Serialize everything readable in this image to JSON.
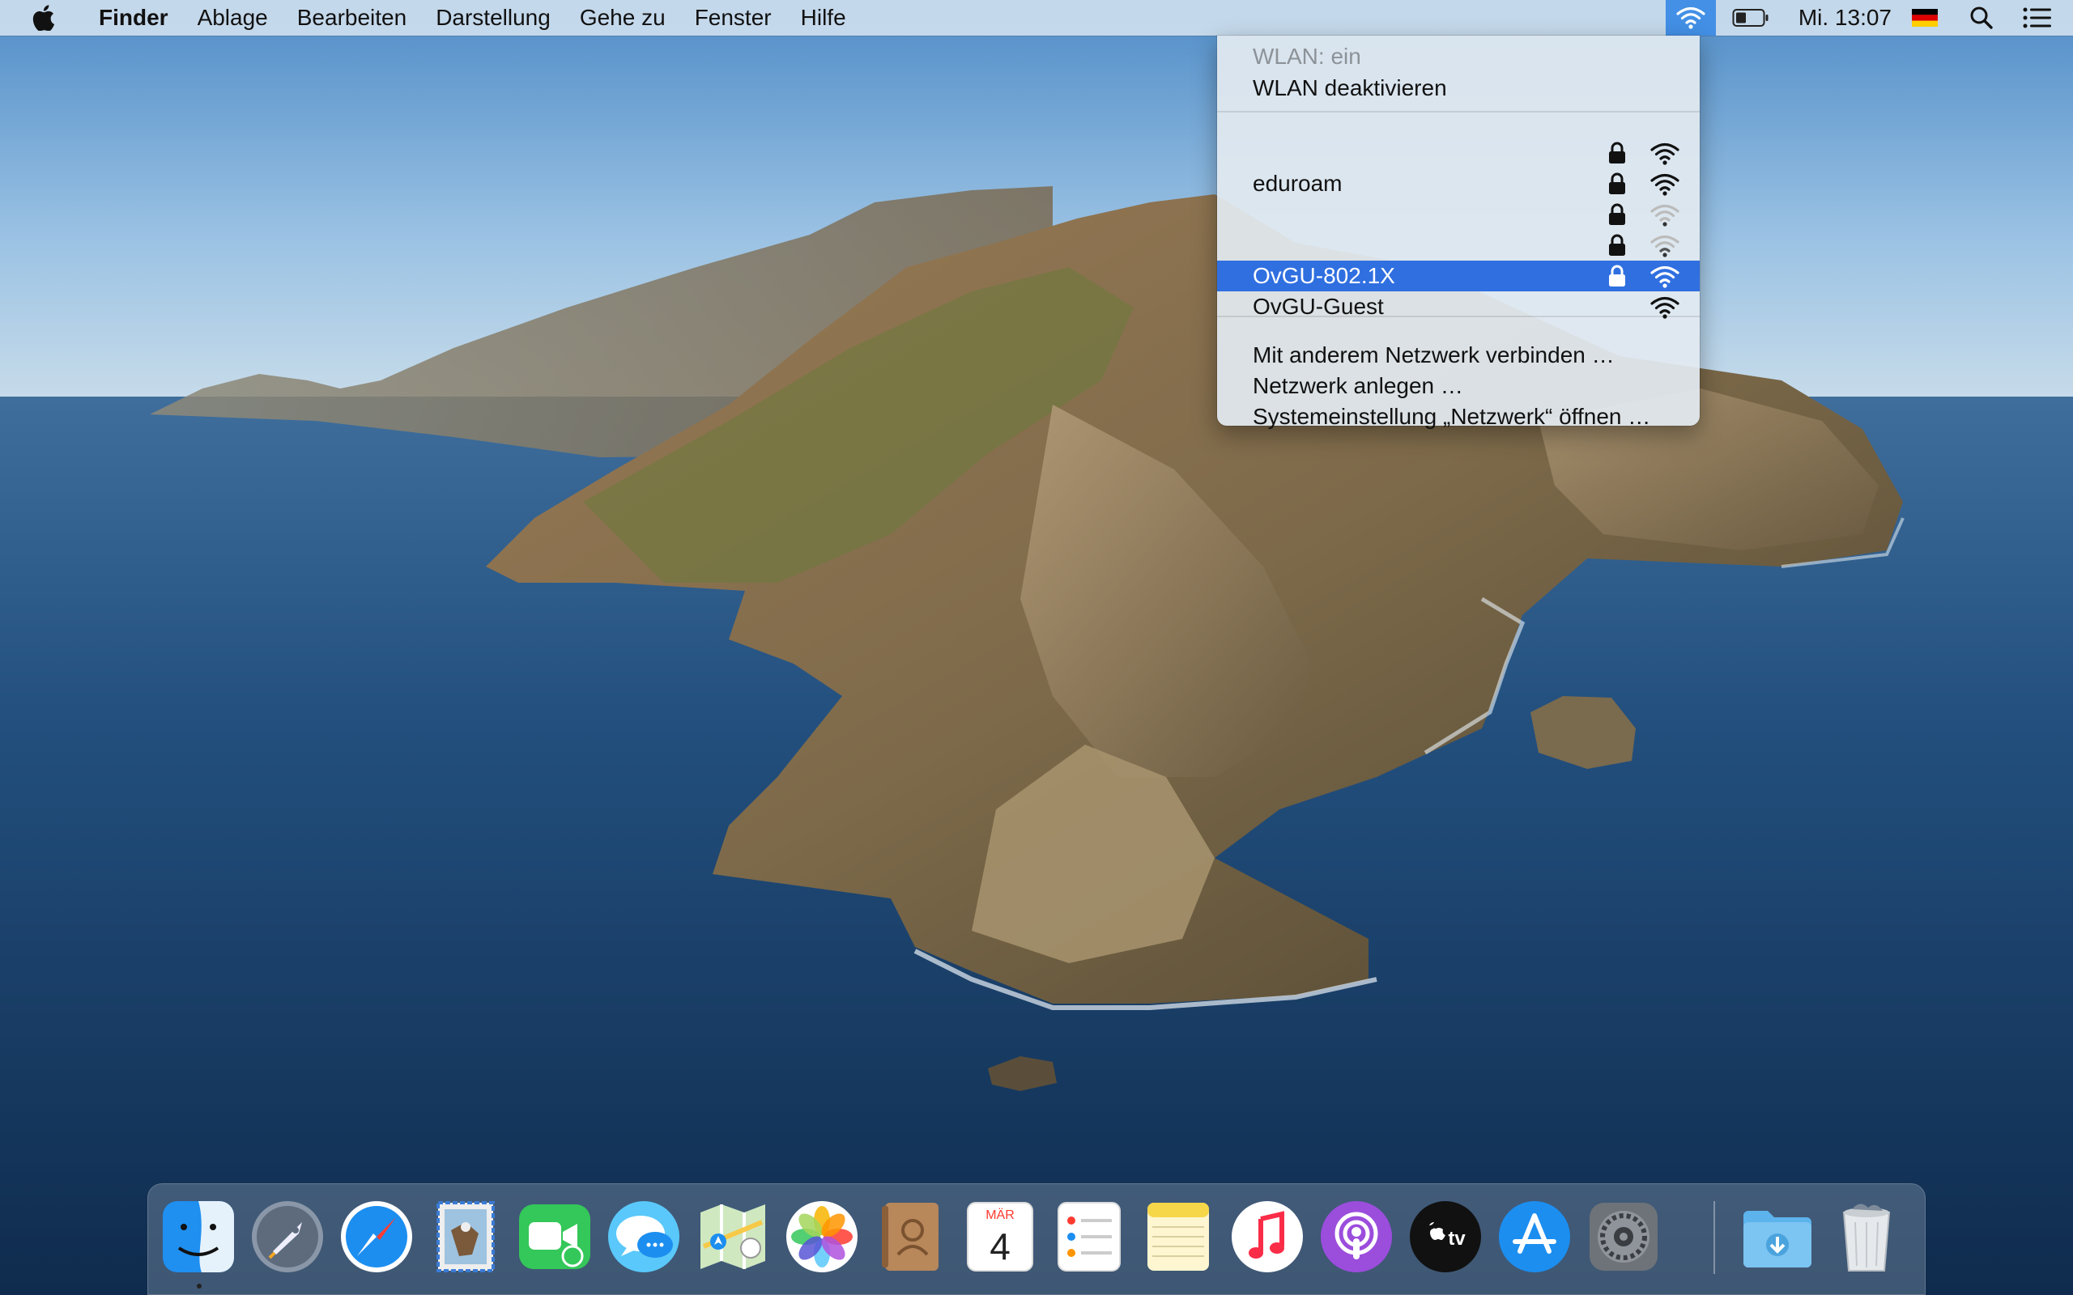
{
  "menubar": {
    "app_name": "Finder",
    "items": [
      "Ablage",
      "Bearbeiten",
      "Darstellung",
      "Gehe zu",
      "Fenster",
      "Hilfe"
    ],
    "clock": "Mi. 13:07",
    "icons": [
      "apple-icon",
      "wifi-icon",
      "battery-icon",
      "german-flag-icon",
      "spotlight-icon",
      "notification-center-icon"
    ]
  },
  "wifi_menu": {
    "status": "WLAN: ein",
    "toggle": "WLAN deaktivieren",
    "networks": [
      {
        "name": "",
        "locked": true,
        "signal": 3
      },
      {
        "name": "eduroam",
        "locked": true,
        "signal": 3
      },
      {
        "name": "",
        "locked": true,
        "signal": 1
      },
      {
        "name": "",
        "locked": true,
        "signal": 1
      },
      {
        "name": "OvGU-802.1X",
        "locked": true,
        "signal": 3,
        "selected": true
      },
      {
        "name": "OvGU-Guest",
        "locked": false,
        "signal": 3
      }
    ],
    "actions": [
      "Mit anderem Netzwerk verbinden …",
      "Netzwerk anlegen …",
      "Systemeinstellung „Netzwerk“ öffnen …"
    ]
  },
  "dock": {
    "apps": [
      "Finder",
      "Launchpad",
      "Safari",
      "Mail",
      "FaceTime",
      "Nachrichten",
      "Karten",
      "Fotos",
      "Kontakte",
      "Kalender",
      "Erinnerungen",
      "Notizen",
      "Musik",
      "Podcasts",
      "TV",
      "App Store",
      "Systemeinstellungen",
      "Downloads",
      "Papierkorb"
    ],
    "calendar_month": "MÄR",
    "calendar_day": "4",
    "tv_label": "tv"
  },
  "colors": {
    "menubar_bg": "#d6e4f0",
    "selection": "#2f6fe0",
    "wifi_active": "#3c8ce6"
  }
}
